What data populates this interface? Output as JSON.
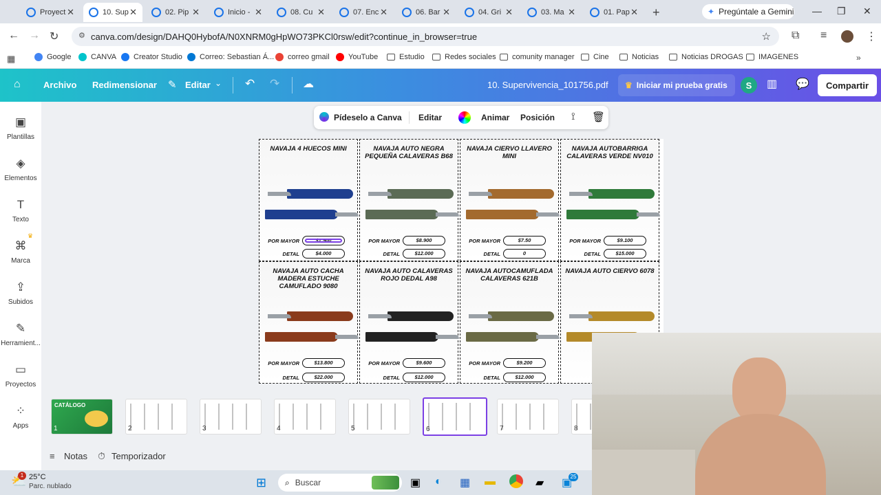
{
  "tabs": [
    {
      "label": "Proyect"
    },
    {
      "label": "10. Sup",
      "active": true
    },
    {
      "label": "02. Pip"
    },
    {
      "label": "Inicio -"
    },
    {
      "label": "08. Cu"
    },
    {
      "label": "07. Enc"
    },
    {
      "label": "06. Bar"
    },
    {
      "label": "04. Gri"
    },
    {
      "label": "03. Ma"
    },
    {
      "label": "01. Pap"
    }
  ],
  "gemini_label": "Pregúntale a Gemini",
  "url": "canva.com/design/DAHQ0HybofA/N0XNRM0gHpWO73PKCl0rsw/edit?continue_in_browser=true",
  "bookmarks": [
    "Google",
    "CANVA",
    "Creator Studio",
    "Correo: Sebastian Á...",
    "correo gmail",
    "YouTube",
    "Estudio",
    "Redes sociales",
    "comunity manager",
    "Cine",
    "Noticias",
    "Noticias DROGAS",
    "IMAGENES"
  ],
  "canva": {
    "archivo": "Archivo",
    "redimensionar": "Redimensionar",
    "editar": "Editar",
    "filename": "10. Supervivencia_101756.pdf",
    "trial": "Iniciar mi prueba gratis",
    "avatar": "S",
    "share": "Compartir"
  },
  "sidebar": [
    "Plantillas",
    "Elementos",
    "Texto",
    "Marca",
    "Subidos",
    "Herramient...",
    "Proyectos",
    "Apps"
  ],
  "floatbar": {
    "ask": "Pídeselo a Canva",
    "edit": "Editar",
    "animate": "Animar",
    "position": "Posición"
  },
  "labels": {
    "mayor": "POR MAYOR",
    "detal": "DETAL"
  },
  "products": [
    {
      "title": "NAVAJA 4 HUECOS MINI",
      "mayor": "$1.900",
      "detal": "$4.000",
      "color": "#1f3f8f"
    },
    {
      "title": "NAVAJA AUTO NEGRA PEQUEÑA CALAVERAS B68",
      "mayor": "$8.900",
      "detal": "$12.000",
      "color": "#5b6b55"
    },
    {
      "title": "NAVAJA CIERVO LLAVERO MINI",
      "mayor": "$7.50",
      "detal": "0",
      "color": "#a36a2e"
    },
    {
      "title": "NAVAJA AUTOBARRIGA CALAVERAS VERDE NV010",
      "mayor": "$9.100",
      "detal": "$15.000",
      "color": "#2f7a3a"
    },
    {
      "title": "NAVAJA AUTO CACHA MADERA ESTUCHE CAMUFLADO 9080",
      "mayor": "$13.800",
      "detal": "$22.000",
      "color": "#8a3b1c"
    },
    {
      "title": "NAVAJA AUTO CALAVERAS ROJO DEDAL A98",
      "mayor": "$9.600",
      "detal": "$12.000",
      "color": "#222222"
    },
    {
      "title": "NAVAJA AUTOCAMUFLADA CALAVERAS 621B",
      "mayor": "$9.200",
      "detal": "$12.000",
      "color": "#6a6a45"
    },
    {
      "title": "NAVAJA AUTO CIERVO 6078",
      "mayor": "",
      "detal": "",
      "color": "#b48a2a"
    }
  ],
  "thumbs": [
    {
      "num": "1",
      "label": "CATÁLOGO"
    },
    {
      "num": "2"
    },
    {
      "num": "3"
    },
    {
      "num": "4"
    },
    {
      "num": "5"
    },
    {
      "num": "6",
      "selected": true
    },
    {
      "num": "7"
    },
    {
      "num": "8"
    }
  ],
  "notes": "Notas",
  "timer": "Temporizador",
  "weather": {
    "temp": "25°C",
    "desc": "Parc. nublado",
    "badge": "1"
  },
  "search": "Buscar",
  "taskbar_badge": "25"
}
